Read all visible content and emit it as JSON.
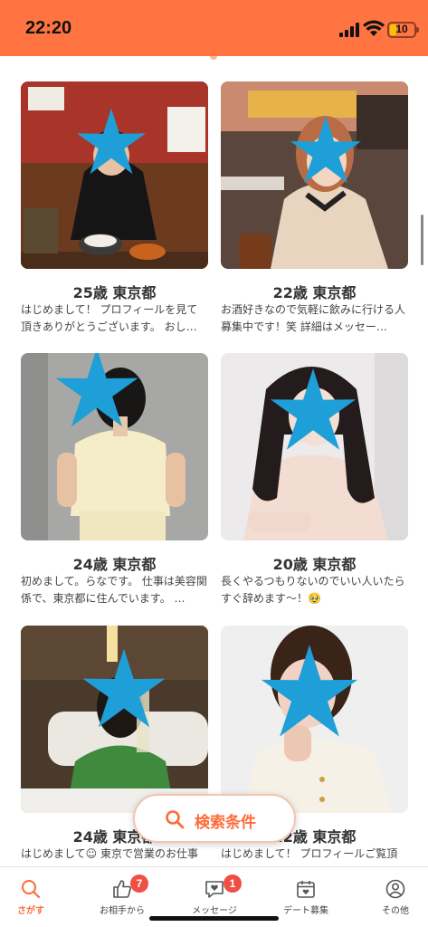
{
  "status_bar": {
    "time": "22:20",
    "battery": "10"
  },
  "profiles": [
    {
      "title": "25歳 東京都",
      "description": "はじめまして！ プロフィールを見て頂きありがとうございます。 おし…"
    },
    {
      "title": "22歳 東京都",
      "description": "お酒好きなので気軽に飲みに行ける人募集中です！笑 詳細はメッセー…"
    },
    {
      "title": "24歳 東京都",
      "description": "初めまして。らなです。 仕事は美容関係で、東京都に住んでいます。 …"
    },
    {
      "title": "20歳 東京都",
      "description": "長くやるつもりないのでいい人いたらすぐ辞めます〜！🥹"
    },
    {
      "title": "24歳 東京都",
      "description": "はじめまして☺ 東京で営業のお仕事"
    },
    {
      "title": "22歳 東京都",
      "description": "はじめまして！ プロフィールご覧頂"
    }
  ],
  "search_button": {
    "label": "検索条件",
    "icon": "search-icon"
  },
  "tabs": [
    {
      "label": "さがす",
      "icon": "search-icon",
      "active": true
    },
    {
      "label": "お相手から",
      "icon": "thumbs-up-icon",
      "badge": "7"
    },
    {
      "label": "メッセージ",
      "icon": "chat-heart-icon",
      "badge": "1"
    },
    {
      "label": "デート募集",
      "icon": "calendar-heart-icon"
    },
    {
      "label": "その他",
      "icon": "profile-icon"
    }
  ],
  "colors": {
    "accent": "#ff7440",
    "accent_text": "#ff6a3a",
    "badge": "#ef4f45",
    "star_mask": "#1e9fd8"
  }
}
